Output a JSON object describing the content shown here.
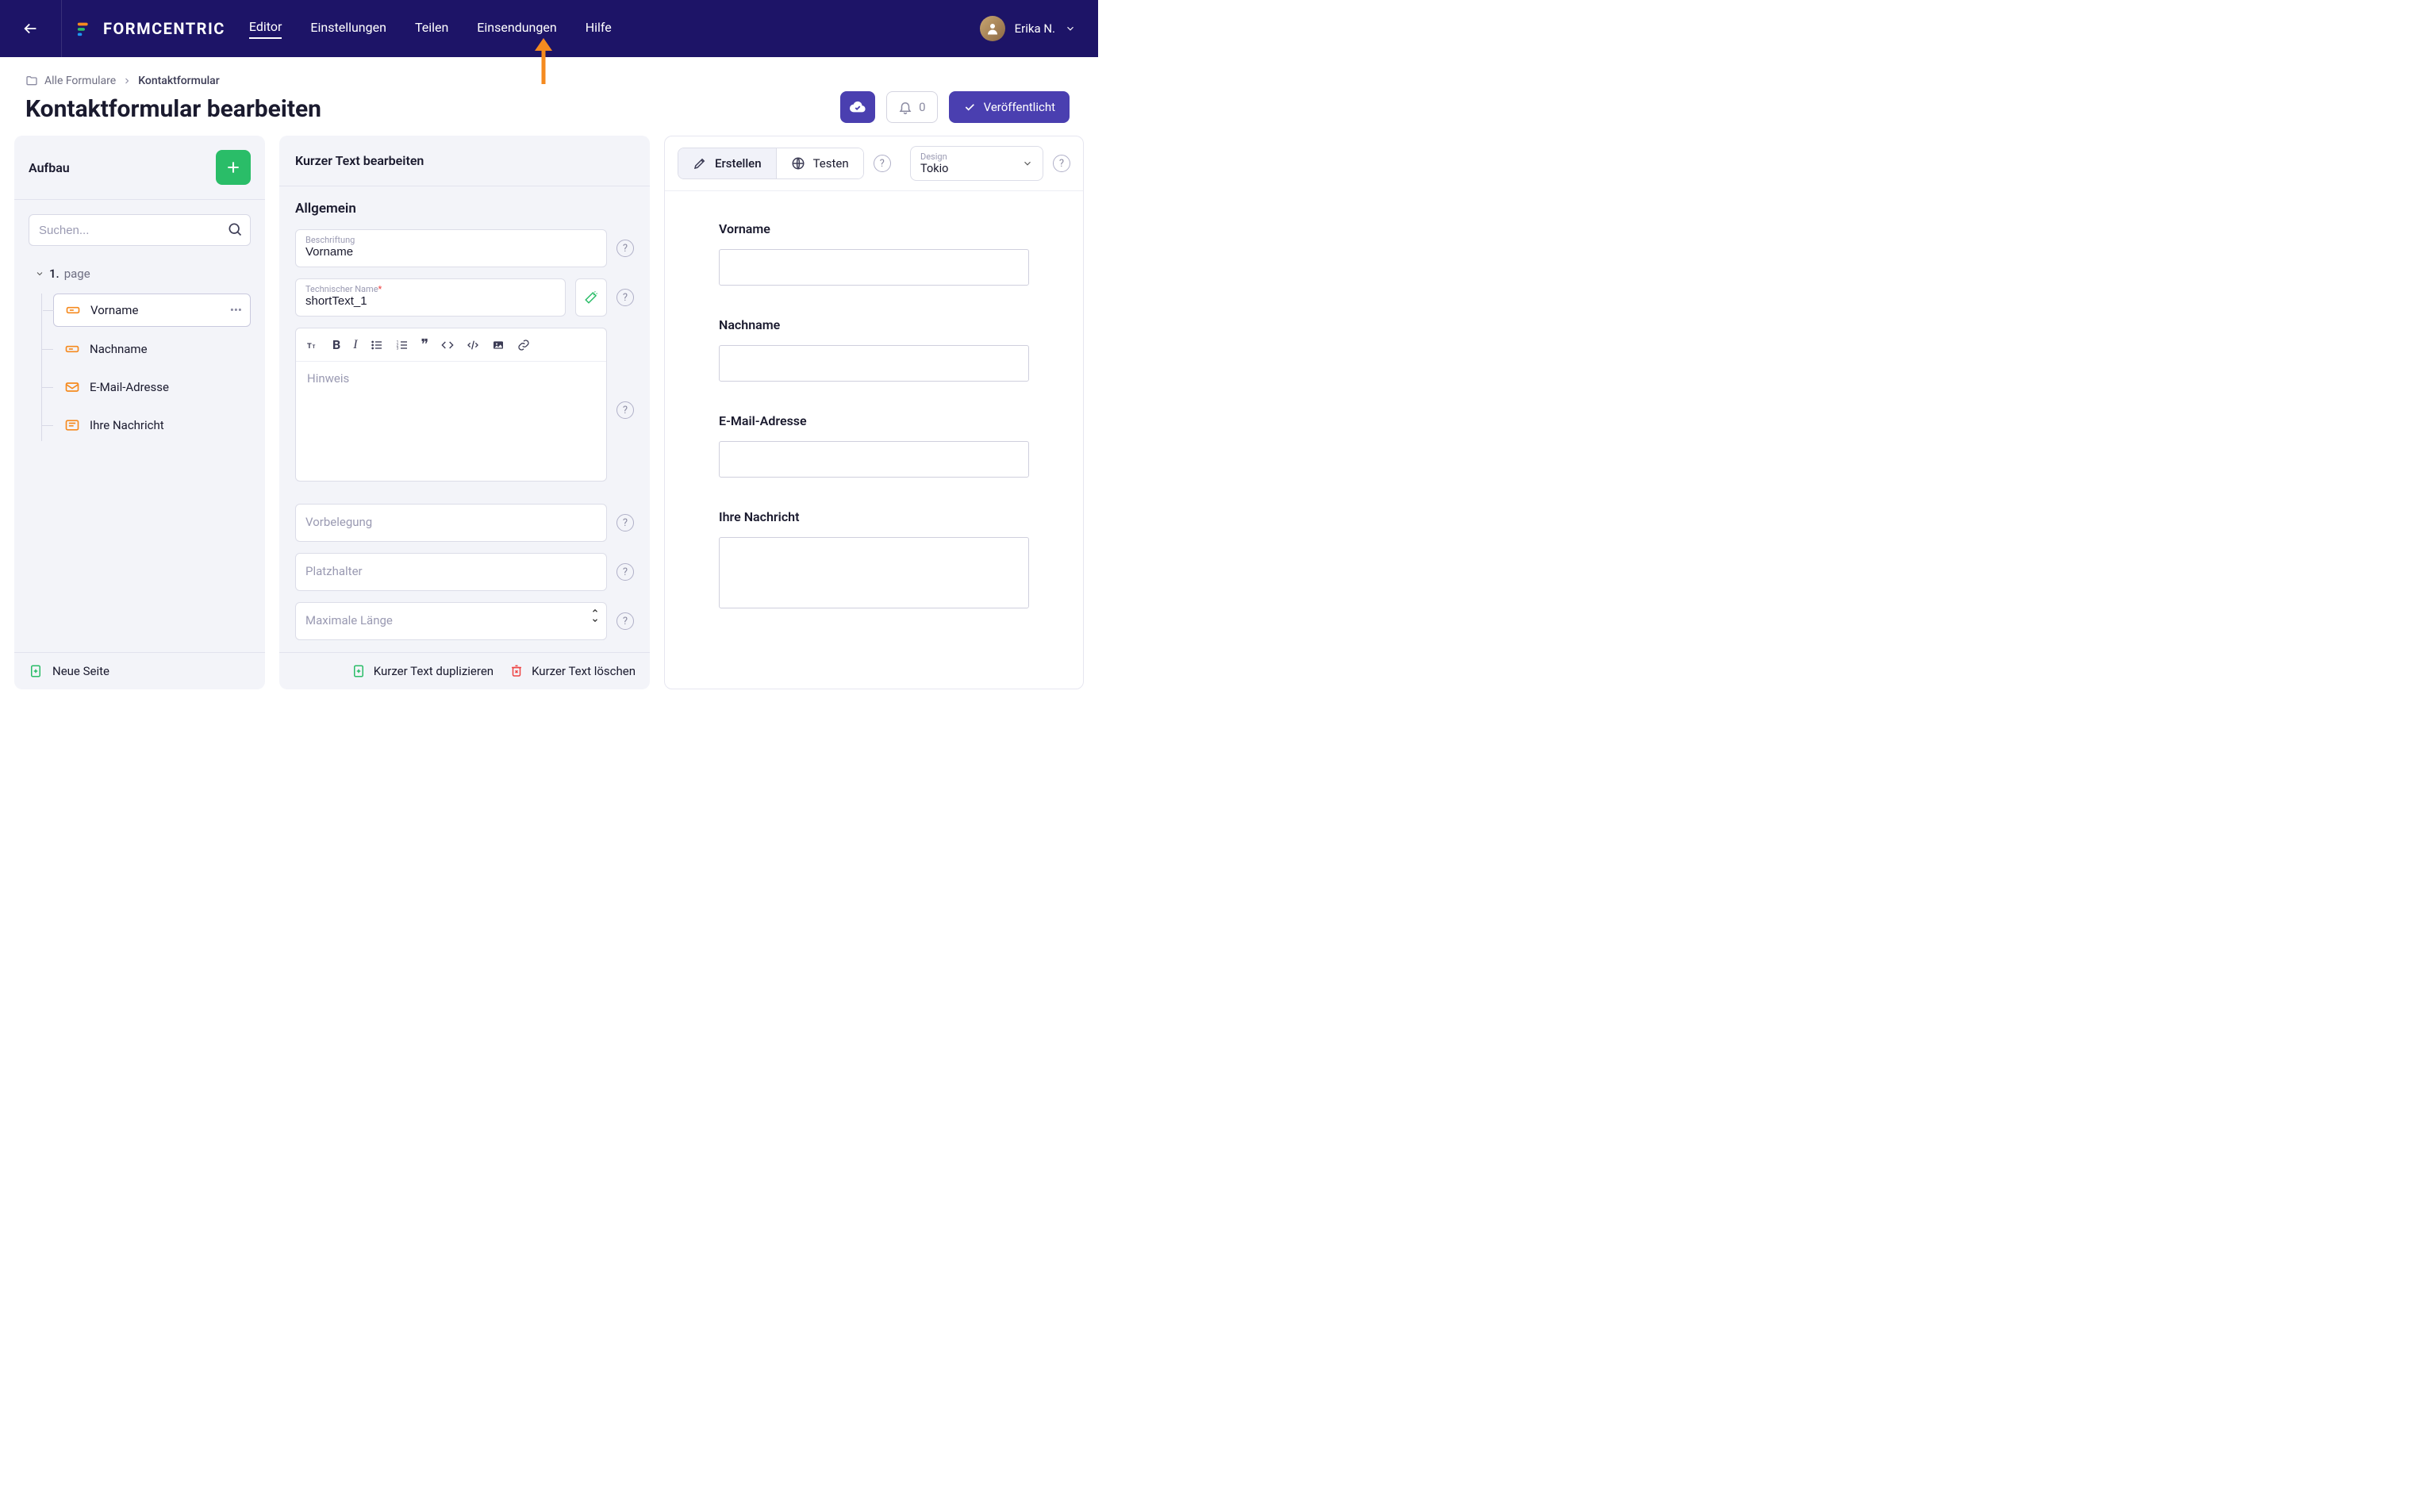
{
  "header": {
    "brand": "FORMCENTRIC",
    "nav": {
      "editor": "Editor",
      "settings": "Einstellungen",
      "share": "Teilen",
      "submissions": "Einsendungen",
      "help": "Hilfe"
    },
    "user_name": "Erika N."
  },
  "subheader": {
    "breadcrumb_root": "Alle Formulare",
    "breadcrumb_current": "Kontaktformular",
    "page_title": "Kontaktformular bearbeiten",
    "notif_count": "0",
    "publish_label": "Veröffentlicht"
  },
  "left": {
    "title": "Aufbau",
    "search_placeholder": "Suchen...",
    "page_num": "1.",
    "page_label": "page",
    "items": [
      {
        "label": "Vorname",
        "icon": "text-field"
      },
      {
        "label": "Nachname",
        "icon": "text-field"
      },
      {
        "label": "E-Mail-Adresse",
        "icon": "email-field"
      },
      {
        "label": "Ihre Nachricht",
        "icon": "textarea-field"
      }
    ],
    "new_page": "Neue Seite"
  },
  "mid": {
    "title": "Kurzer Text bearbeiten",
    "section": "Allgemein",
    "label_field_label": "Beschriftung",
    "label_field_value": "Vorname",
    "techname_label": "Technischer Name",
    "techname_value": "shortText_1",
    "hint_placeholder": "Hinweis",
    "prefill_placeholder": "Vorbelegung",
    "placeholder_placeholder": "Platzhalter",
    "maxlen_placeholder": "Maximale Länge",
    "duplicate": "Kurzer Text duplizieren",
    "delete": "Kurzer Text löschen"
  },
  "right": {
    "create": "Erstellen",
    "test": "Testen",
    "design_label": "Design",
    "design_value": "Tokio",
    "fields": {
      "vorname": "Vorname",
      "nachname": "Nachname",
      "email": "E-Mail-Adresse",
      "nachricht": "Ihre Nachricht"
    }
  }
}
